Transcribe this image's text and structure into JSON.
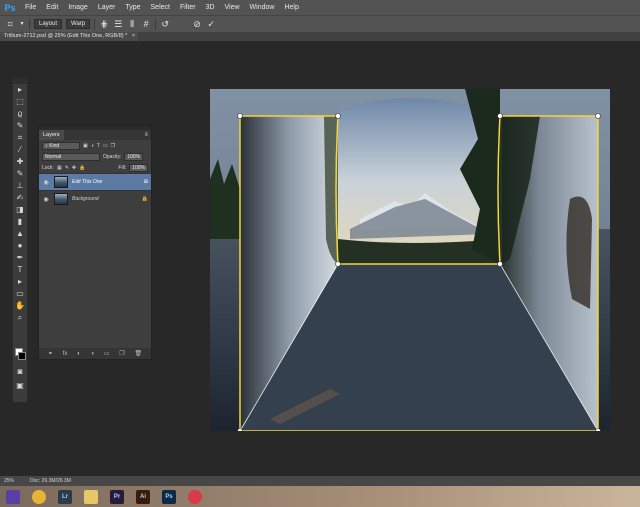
{
  "app": {
    "logo": "Ps",
    "menu": [
      "File",
      "Edit",
      "Image",
      "Layer",
      "Type",
      "Select",
      "Filter",
      "3D",
      "View",
      "Window",
      "Help"
    ]
  },
  "options_bar": {
    "layout_label": "Layout",
    "warp_label": "Warp",
    "icons": [
      "puppet-warp-icon",
      "grid-icon",
      "rows-icon",
      "columns-icon",
      "hash-icon",
      "rotate-icon",
      "cancel-icon",
      "commit-icon"
    ]
  },
  "document": {
    "tab_title": "Trillium-2712.psd @ 25% (Edit This One, RGB/8) *",
    "tab_close": "×"
  },
  "tools": [
    "move-tool-icon",
    "marquee-tool-icon",
    "lasso-tool-icon",
    "quick-select-tool-icon",
    "crop-tool-icon",
    "eyedropper-tool-icon",
    "healing-brush-icon",
    "brush-tool-icon",
    "clone-stamp-icon",
    "history-brush-icon",
    "eraser-tool-icon",
    "gradient-tool-icon",
    "blur-tool-icon",
    "dodge-tool-icon",
    "pen-tool-icon",
    "type-tool-icon",
    "path-select-icon",
    "shape-tool-icon",
    "hand-tool-icon",
    "zoom-tool-icon"
  ],
  "tool_glyphs": [
    "▸",
    "⬚",
    "ϱ",
    "✎",
    "⌗",
    "⁄",
    "✚",
    "✎",
    "⊥",
    "✍",
    "◨",
    "▮",
    "▲",
    "●",
    "✒",
    "T",
    "▸",
    "▭",
    "✋",
    "⌕"
  ],
  "layers_panel": {
    "tab_label": "Layers",
    "filter_label": "Kind",
    "blend_mode": "Normal",
    "opacity_label": "Opacity:",
    "opacity_value": "100%",
    "lock_label": "Lock:",
    "fill_label": "Fill:",
    "fill_value": "100%",
    "layers": [
      {
        "name": "Edit This One",
        "selected": true
      },
      {
        "name": "Background",
        "selected": false
      }
    ],
    "footer_icons": [
      "link-icon",
      "fx-icon",
      "mask-icon",
      "adjustment-icon",
      "folder-icon",
      "new-layer-icon",
      "trash-icon"
    ],
    "footer_glyphs": [
      "⚭",
      "fx",
      "◐",
      "◑",
      "▭",
      "❐",
      "🗑"
    ]
  },
  "status": {
    "zoom": "25%",
    "doc_info": "Doc: 26.3M/26.3M"
  },
  "taskbar": {
    "apps": [
      {
        "name": "start-icon",
        "label": "",
        "color": "#5a3ea8"
      },
      {
        "name": "chrome-icon",
        "label": "",
        "color": "#e9b33a"
      },
      {
        "name": "lightroom-icon",
        "label": "Lr",
        "color": "#2c3a4a"
      },
      {
        "name": "folder-icon",
        "label": "",
        "color": "#e8c766"
      },
      {
        "name": "premiere-icon",
        "label": "Pr",
        "color": "#2a1a3a"
      },
      {
        "name": "illustrator-icon",
        "label": "Ai",
        "color": "#3a1a08"
      },
      {
        "name": "photoshop-icon",
        "label": "Ps",
        "color": "#0c2a44"
      },
      {
        "name": "itunes-icon",
        "label": "",
        "color": "#d83a4a"
      }
    ]
  },
  "colors": {
    "warp_frame": "#f2d63a",
    "selected_layer": "#5b7ba4",
    "ps_blue": "#31a8ff"
  }
}
